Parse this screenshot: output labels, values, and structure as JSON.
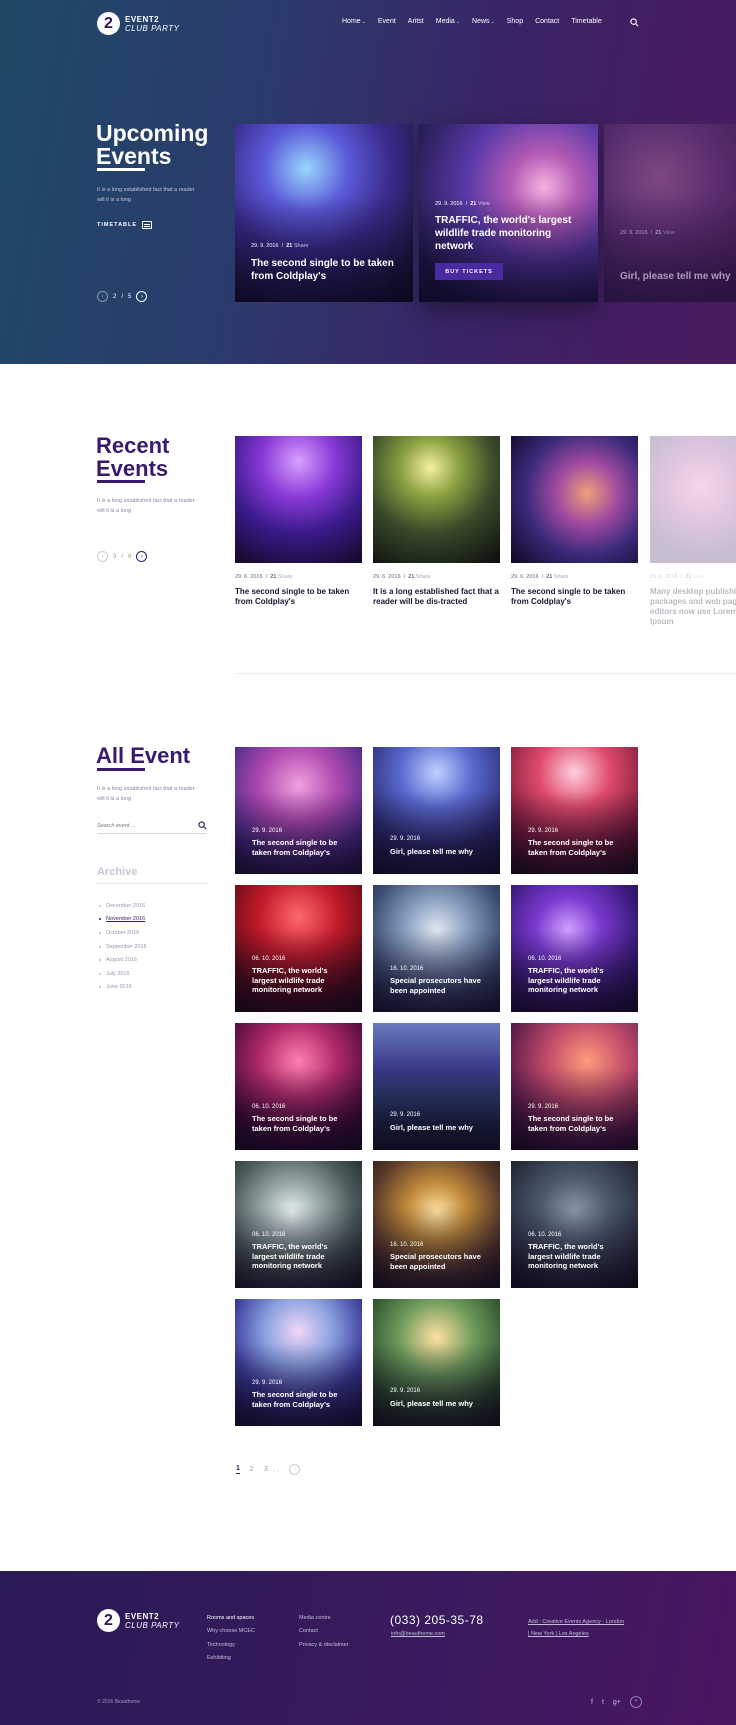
{
  "brand": {
    "logo_digit": "2",
    "line1": "EVENT2",
    "line2": "CLUB PARTY"
  },
  "nav": {
    "items": [
      {
        "label": "Home",
        "caret": true
      },
      {
        "label": "Event",
        "caret": false
      },
      {
        "label": "Aritst",
        "caret": false
      },
      {
        "label": "Media",
        "caret": true
      },
      {
        "label": "News",
        "caret": true
      },
      {
        "label": "Shop",
        "caret": false
      },
      {
        "label": "Contact",
        "caret": false
      },
      {
        "label": "Timetable",
        "caret": false
      }
    ],
    "search_icon": "search-icon"
  },
  "upcoming": {
    "title_line1": "Upcoming",
    "title_line2": "Events",
    "description": "It is a long established fact that a reader will it is a long",
    "timetable_label": "TIMETABLE",
    "pager": {
      "current": "2",
      "separator": "/",
      "total": "5",
      "prev": "‹",
      "next": "›"
    },
    "cards": [
      {
        "date": "29. 9. 2016",
        "sep": "/",
        "count": "21",
        "count_label": "Share",
        "title": "The second single to be taken from Coldplay's"
      },
      {
        "date": "29. 9. 2016",
        "sep": "/",
        "count": "21",
        "count_label": "View",
        "title": "TRAFFIC, the world's largest wildlife trade monitoring network",
        "button": "BUY TICKETS"
      },
      {
        "date": "29. 9. 2016",
        "sep": "/",
        "count": "21",
        "count_label": "View",
        "title": "Girl, please tell me why"
      }
    ]
  },
  "recent": {
    "title_line1": "Recent",
    "title_line2": "Events",
    "description": "It is a long established fact that a reader will it is a long",
    "pager": {
      "current": "3",
      "separator": "/",
      "total": "8",
      "prev": "‹",
      "next": "›"
    },
    "cards": [
      {
        "date": "29. 6. 2016",
        "sep": "/",
        "count": "21",
        "count_label": "Share",
        "title": "The second single to be taken from Coldplay's"
      },
      {
        "date": "29. 6. 2016",
        "sep": "/",
        "count": "21",
        "count_label": "Share",
        "title": "It is a long established fact that a reader will be dis-tracted"
      },
      {
        "date": "29. 6. 2016",
        "sep": "/",
        "count": "21",
        "count_label": "Share",
        "title": "The second single to be taken from Coldplay's"
      },
      {
        "date": "29. 6. 2016",
        "sep": "/",
        "count": "21",
        "count_label": "View",
        "title": "Many desktop publishing packages and web page editors now use Lorem Ipsum"
      }
    ]
  },
  "all_event": {
    "title": "All Event",
    "description": "It is a long established fact that a reader will it is a long",
    "search_placeholder": "Search event ...",
    "archive_title": "Archive",
    "archive": [
      "December 2016",
      "November 2016",
      "October 2016",
      "September 2016",
      "August 2016",
      "July 2016",
      "June 2016"
    ],
    "archive_active": 1,
    "grid": [
      {
        "date": "29. 9. 2016",
        "title": "The second single to be taken from Coldplay's"
      },
      {
        "date": "29. 9. 2016",
        "title": "Girl, please tell me why"
      },
      {
        "date": "29. 9. 2016",
        "title": "The second single to be taken from Coldplay's"
      },
      {
        "date": "06. 10. 2016",
        "title": "TRAFFIC, the world's largest wildlife trade monitoring network"
      },
      {
        "date": "16. 10. 2016",
        "title": "Special prosecutors have been appointed"
      },
      {
        "date": "06. 10. 2016",
        "title": "TRAFFIC, the world's largest wildlife trade monitoring network"
      },
      {
        "date": "06. 10. 2016",
        "title": "The second single to be taken from Coldplay's"
      },
      {
        "date": "29. 9. 2016",
        "title": "Girl, please tell me why"
      },
      {
        "date": "29. 9. 2016",
        "title": "The second single to be taken from Coldplay's"
      },
      {
        "date": "06. 10. 2016",
        "title": "TRAFFIC, the world's largest wildlife trade monitoring network"
      },
      {
        "date": "16. 10. 2016",
        "title": "Special prosecutors have been appointed"
      },
      {
        "date": "06. 10. 2016",
        "title": "TRAFFIC, the world's largest wildlife trade monitoring network"
      },
      {
        "date": "29. 9. 2016",
        "title": "The second single to be taken from Coldplay's"
      },
      {
        "date": "29. 9. 2016",
        "title": "Girl, please tell me why"
      }
    ],
    "pagination": {
      "p1": "1",
      "p2": "2",
      "p3": "3 . . .",
      "next": "›"
    }
  },
  "footer": {
    "col1": [
      "Rooms and spaces",
      "Why choose MCEC",
      "Technology",
      "Exhibiting"
    ],
    "col2": [
      "Media centre",
      "Contact",
      "Privacy & disclaimer"
    ],
    "phone": "(033) 205-35-78",
    "email": "info@beautheme.com",
    "address_line1": "Add : Creative Events Agency - London",
    "address_line2": "| New York | Los Angeles",
    "copyright": "© 2016 Beautheme",
    "social": {
      "facebook": "f",
      "twitter": "t",
      "google": "g+"
    },
    "up_icon": "up-arrow-icon"
  },
  "colors": {
    "accent": "#3a1a6e",
    "button": "#4a2aa0",
    "footer": "#2a1a55"
  }
}
